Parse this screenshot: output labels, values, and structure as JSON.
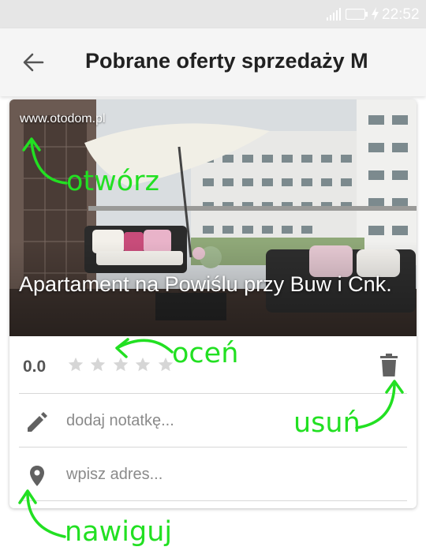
{
  "status_bar": {
    "time": "22:52"
  },
  "app_bar": {
    "title": "Pobrane oferty sprzedaży M"
  },
  "card": {
    "source_url": "www.otodom.pl",
    "title": "Apartament na Powiślu przy Buw i Cnk.",
    "rating": {
      "value": "0.0",
      "stars_max": 5,
      "stars_filled": 0
    },
    "note_placeholder": "dodaj notatkę...",
    "address_placeholder": "wpisz adres..."
  },
  "annotations": {
    "open": "otwórz",
    "rate": "oceń",
    "delete": "usuń",
    "navigate": "nawiguj"
  },
  "colors": {
    "annotation": "#22e022",
    "icon": "#616161",
    "star_empty": "#d6d6d6"
  },
  "icons": [
    "signal-icon",
    "battery-icon",
    "charging-icon",
    "back-arrow-icon",
    "star-icon",
    "trash-icon",
    "pencil-icon",
    "location-pin-icon"
  ]
}
